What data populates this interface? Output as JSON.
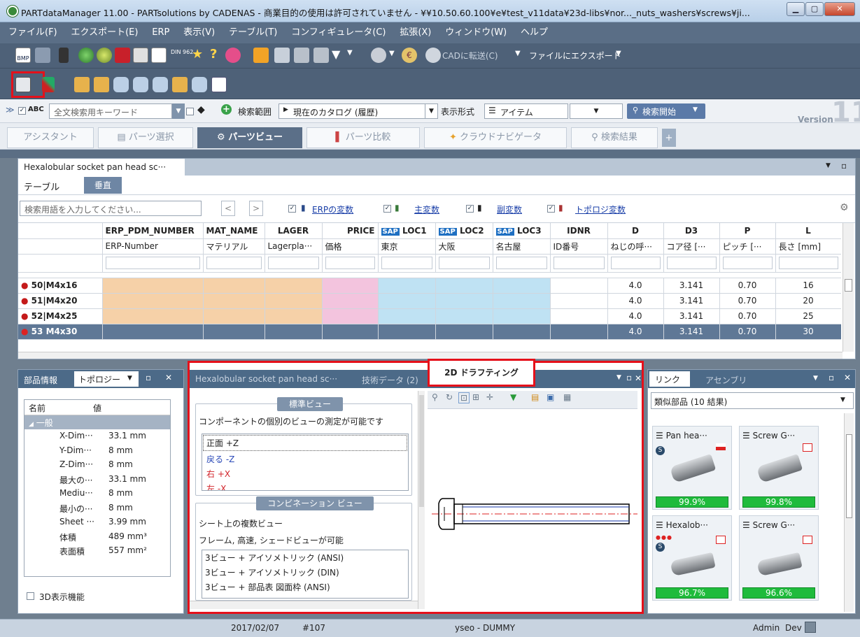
{
  "window": {
    "title": "PARTdataManager 11.00 - PARTsolutions by CADENAS - 商業目的の使用は許可されていません - ¥¥10.50.60.100¥e¥test_v11data¥23d-libs¥nor..._nuts_washers¥screws¥ji..."
  },
  "menu": [
    "ファイル(F)",
    "エクスポート(E)",
    "ERP",
    "表示(V)",
    "テーブル(T)",
    "コンフィギュレータ(C)",
    "拡張(X)",
    "ウィンドウ(W)",
    "ヘルプ"
  ],
  "toolbar": {
    "cad_transfer": "CADに転送(C)",
    "file_export": "ファイルにエクスポート",
    "bmp": "BMP",
    "din": "DIN 962"
  },
  "search": {
    "abc": "ABC",
    "placeholder": "全文検索用キーワード",
    "scope_label": "検索範囲",
    "scope_value": "現在のカタログ (履歴)",
    "display_label": "表示形式",
    "display_value": "アイテム",
    "start": "検索開始",
    "version_word": "Version",
    "version_num": "11"
  },
  "tabs": [
    "アシスタント",
    "パーツ選択",
    "パーツビュー",
    "パーツ比較",
    "クラウドナビゲータ",
    "検索結果"
  ],
  "table_panel": {
    "title": "Hexalobular socket pan head sc···",
    "subtab_table": "テーブル",
    "subtab_vertical": "垂直",
    "search_placeholder": "検索用語を入力してください...",
    "filters": [
      "ERPの変数",
      "主変数",
      "副変数",
      "トポロジ変数"
    ]
  },
  "grid": {
    "headers": [
      "ERP_PDM_NUMBER",
      "MAT_NAME",
      "LAGER",
      "PRICE",
      "LOC1",
      "LOC2",
      "LOC3",
      "IDNR",
      "D",
      "D3",
      "P",
      "L"
    ],
    "sap": "SAP",
    "subheaders": [
      "ERP-Number",
      "マテリアル",
      "Lagerpla···",
      "価格",
      "東京",
      "大阪",
      "名古屋",
      "ID番号",
      "ねじの呼···",
      "コア径 [···",
      "ピッチ [···",
      "長さ [mm]"
    ],
    "rows": [
      {
        "no": "50",
        "name": "M4x16",
        "D": "4.0",
        "D3": "3.141",
        "P": "0.70",
        "L": "16"
      },
      {
        "no": "51",
        "name": "M4x20",
        "D": "4.0",
        "D3": "3.141",
        "P": "0.70",
        "L": "20"
      },
      {
        "no": "52",
        "name": "M4x25",
        "D": "4.0",
        "D3": "3.141",
        "P": "0.70",
        "L": "25"
      },
      {
        "no": "53",
        "name": "M4x30",
        "D": "4.0",
        "D3": "3.141",
        "P": "0.70",
        "L": "30"
      }
    ]
  },
  "left_panel": {
    "tab1": "部品情報",
    "tab2": "トポロジー",
    "col_name": "名前",
    "col_value": "値",
    "group": "一般",
    "rows": [
      [
        "X-Dim···",
        "33.1 mm"
      ],
      [
        "Y-Dim···",
        "8 mm"
      ],
      [
        "Z-Dim···",
        "8 mm"
      ],
      [
        "最大の···",
        "33.1 mm"
      ],
      [
        "Mediu···",
        "8 mm"
      ],
      [
        "最小の···",
        "8 mm"
      ],
      [
        "Sheet ···",
        "3.99 mm"
      ],
      [
        "体積",
        "489 mm³"
      ],
      [
        "表面積",
        "557 mm²"
      ]
    ],
    "checkbox_3d": "3D表示機能"
  },
  "center_panel": {
    "tab1": "Hexalobular socket pan head sc···",
    "tab2": "技術データ (2)",
    "tab3": "2D ドラフティング",
    "std_title": "標準ビュー",
    "std_desc": "コンポーネントの個別のビューの測定が可能です",
    "views": [
      "正面 +Z",
      "戻る -Z",
      "右 +X",
      "左 -X"
    ],
    "combo_title": "コンビネーション ビュー",
    "combo_desc1": "シート上の複数ビュー",
    "combo_desc2": "フレーム, 高速, シェードビューが可能",
    "combos": [
      "3ビュー + アイソメトリック (ANSI)",
      "3ビュー + アイソメトリック (DIN)",
      "3ビュー + 部品表 図面枠 (ANSI)"
    ]
  },
  "right_panel": {
    "tab1": "リンク",
    "tab2": "アセンブリ",
    "dropdown": "類似部品 (10 結果)",
    "cards": [
      {
        "name": "Pan hea···",
        "pct": "99.9%"
      },
      {
        "name": "Screw G···",
        "pct": "99.8%"
      },
      {
        "name": "Hexalob···",
        "pct": "96.7%"
      },
      {
        "name": "Screw G···",
        "pct": "96.6%"
      }
    ]
  },
  "status": {
    "date": "2017/02/07",
    "num": "#107",
    "user": "yseo - DUMMY",
    "admin": "Admin",
    "dev": "Dev"
  }
}
